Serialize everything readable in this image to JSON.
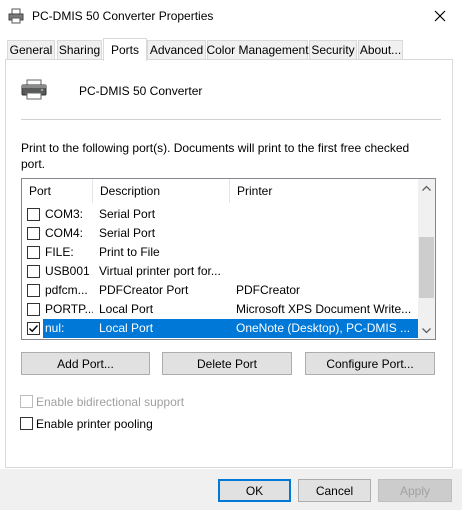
{
  "window": {
    "title": "PC-DMIS 50 Converter Properties",
    "close_icon": "close-icon"
  },
  "tabs": [
    {
      "label": "General",
      "active": false
    },
    {
      "label": "Sharing",
      "active": false
    },
    {
      "label": "Ports",
      "active": true
    },
    {
      "label": "Advanced",
      "active": false
    },
    {
      "label": "Color Management",
      "active": false
    },
    {
      "label": "Security",
      "active": false
    },
    {
      "label": "About...",
      "active": false
    }
  ],
  "printer": {
    "name": "PC-DMIS 50 Converter",
    "icon": "printer-icon"
  },
  "ports_description": "Print to the following port(s). Documents will print to the first free checked port.",
  "port_list": {
    "columns": [
      "Port",
      "Description",
      "Printer"
    ],
    "rows": [
      {
        "port": "COM3:",
        "description": "Serial Port",
        "printer": "",
        "checked": false,
        "selected": false
      },
      {
        "port": "COM4:",
        "description": "Serial Port",
        "printer": "",
        "checked": false,
        "selected": false
      },
      {
        "port": "FILE:",
        "description": "Print to File",
        "printer": "",
        "checked": false,
        "selected": false
      },
      {
        "port": "USB001",
        "description": "Virtual printer port for...",
        "printer": "",
        "checked": false,
        "selected": false
      },
      {
        "port": "pdfcm...",
        "description": "PDFCreator Port",
        "printer": "PDFCreator",
        "checked": false,
        "selected": false
      },
      {
        "port": "PORTP...",
        "description": "Local Port",
        "printer": "Microsoft XPS Document Write...",
        "checked": false,
        "selected": false
      },
      {
        "port": "nul:",
        "description": "Local Port",
        "printer": "OneNote (Desktop), PC-DMIS ...",
        "checked": true,
        "selected": true
      }
    ]
  },
  "port_buttons": {
    "add": "Add Port...",
    "delete": "Delete Port",
    "configure": "Configure Port..."
  },
  "options": {
    "bidirectional": {
      "label": "Enable bidirectional support",
      "checked": false,
      "enabled": false
    },
    "pooling": {
      "label": "Enable printer pooling",
      "checked": false,
      "enabled": true
    }
  },
  "dialog_buttons": {
    "ok": "OK",
    "cancel": "Cancel",
    "apply": "Apply"
  },
  "colors": {
    "selection": "#0078d7",
    "default_button_border": "#0078d7"
  }
}
